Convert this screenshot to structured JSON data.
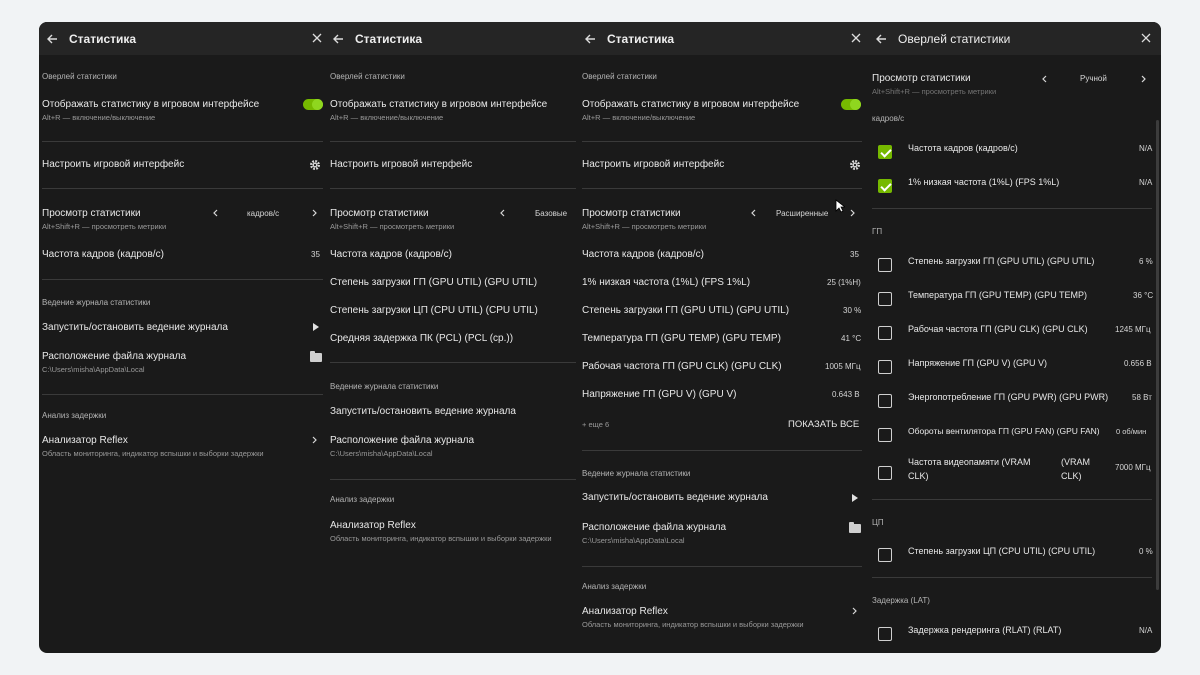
{
  "window": {
    "accent_color": "#76b900",
    "background_color": "#1a1a1a"
  },
  "panel1": {
    "title": "Статистика",
    "overlay_section": "Оверлей статистики",
    "show_stats_label": "Отображать статистику в игровом интерфейсе",
    "show_stats_hint": "Alt+R — включение/выключение",
    "customize_label": "Настроить игровой интерфейс",
    "view_label": "Просмотр статистики",
    "view_hint": "Alt+Shift+R — просмотреть метрики",
    "view_value": "кадров/с",
    "metrics": [
      {
        "label": "Частота кадров (кадров/с)",
        "value": "35"
      }
    ],
    "log_section": "Ведение журнала статистики",
    "log_toggle_label": "Запустить/остановить ведение журнала",
    "log_location_label": "Расположение файла журнала",
    "log_location_path": "C:\\Users\\misha\\AppData\\Local",
    "latency_section": "Анализ задержки",
    "reflex_label": "Анализатор Reflex",
    "reflex_hint": "Область мониторинга, индикатор вспышки и выборки задержки"
  },
  "panel2": {
    "title": "Статистика",
    "overlay_section": "Оверлей статистики",
    "show_stats_label": "Отображать статистику в игровом интерфейсе",
    "show_stats_hint": "Alt+R — включение/выключение",
    "customize_label": "Настроить игровой интерфейс",
    "view_label": "Просмотр статистики",
    "view_hint": "Alt+Shift+R — просмотреть метрики",
    "view_value": "Базовые",
    "metrics": [
      {
        "label": "Частота кадров (кадров/с)"
      },
      {
        "label": "Степень загрузки ГП (GPU UTIL) (GPU UTIL)"
      },
      {
        "label": "Степень загрузки ЦП (CPU UTIL) (CPU UTIL)"
      },
      {
        "label": "Средняя задержка ПК (PCL) (PCL (ср.))"
      }
    ],
    "log_section": "Ведение журнала статистики",
    "log_toggle_label": "Запустить/остановить ведение журнала",
    "log_location_label": "Расположение файла журнала",
    "log_location_path": "C:\\Users\\misha\\AppData\\Local",
    "latency_section": "Анализ задержки",
    "reflex_label": "Анализатор Reflex",
    "reflex_hint": "Область мониторинга, индикатор вспышки и выборки задержки"
  },
  "panel3": {
    "title": "Статистика",
    "overlay_section": "Оверлей статистики",
    "show_stats_label": "Отображать статистику в игровом интерфейсе",
    "show_stats_hint": "Alt+R — включение/выключение",
    "customize_label": "Настроить игровой интерфейс",
    "view_label": "Просмотр статистики",
    "view_hint": "Alt+Shift+R — просмотреть метрики",
    "view_value": "Расширенные",
    "metrics": [
      {
        "label": "Частота кадров (кадров/с)",
        "value": "35"
      },
      {
        "label": "1% низкая частота (1%L) (FPS 1%L)",
        "value": "25 (1%H)"
      },
      {
        "label": "Степень загрузки ГП (GPU UTIL) (GPU UTIL)",
        "value": "30 %"
      },
      {
        "label": "Температура ГП (GPU TEMP) (GPU TEMP)",
        "value": "41 °C"
      },
      {
        "label": "Рабочая частота ГП (GPU CLK) (GPU CLK)",
        "value": "1005 МГц"
      },
      {
        "label": "Напряжение ГП (GPU V) (GPU V)",
        "value": "0.643 В"
      }
    ],
    "more_label": "+ еще 6",
    "show_all_label": "ПОКАЗАТЬ ВСЕ",
    "log_section": "Ведение журнала статистики",
    "log_toggle_label": "Запустить/остановить ведение журнала",
    "log_location_label": "Расположение файла журнала",
    "log_location_path": "C:\\Users\\misha\\AppData\\Local",
    "latency_section": "Анализ задержки",
    "reflex_label": "Анализатор Reflex",
    "reflex_hint": "Область мониторинга, индикатор вспышки и выборки задержки"
  },
  "panel4": {
    "title": "Оверлей статистики",
    "view_label": "Просмотр статистики",
    "view_hint": "Alt+Shift+R — просмотреть метрики",
    "view_value": "Ручной",
    "fps_section": "кадров/с",
    "fps_items": [
      {
        "label": "Частота кадров (кадров/с)",
        "value": "N/A",
        "checked": true
      },
      {
        "label": "1% низкая частота (1%L) (FPS 1%L)",
        "value": "N/A",
        "checked": true
      }
    ],
    "gpu_section": "ГП",
    "gpu_items": [
      {
        "label": "Степень загрузки ГП (GPU UTIL) (GPU UTIL)",
        "value": "6 %",
        "checked": false
      },
      {
        "label": "Температура ГП (GPU TEMP) (GPU TEMP)",
        "value": "36 °C",
        "checked": false
      },
      {
        "label": "Рабочая частота ГП (GPU CLK) (GPU CLK)",
        "value": "1245 МГц",
        "checked": false
      },
      {
        "label": "Напряжение ГП (GPU V) (GPU V)",
        "value": "0.656 В",
        "checked": false
      },
      {
        "label": "Энергопотребление ГП (GPU PWR) (GPU PWR)",
        "value": "58 Вт",
        "checked": false
      },
      {
        "label": "Обороты вентилятора ГП (GPU FAN) (GPU FAN)",
        "value": "0 об/мин",
        "checked": false
      }
    ],
    "vram_label_1": "Частота видеопамяти (VRAM",
    "vram_label_2": "CLK)",
    "vram_short_1": "(VRAM",
    "vram_short_2": "CLK)",
    "vram_value": "7000 МГц",
    "cpu_section": "ЦП",
    "cpu_items": [
      {
        "label": "Степень загрузки ЦП (CPU UTIL) (CPU UTIL)",
        "value": "0 %",
        "checked": false
      }
    ],
    "lat_section": "Задержка (LAT)",
    "lat_items": [
      {
        "label": "Задержка рендеринга (RLAT) (RLAT)",
        "value": "N/A",
        "checked": false
      }
    ]
  }
}
